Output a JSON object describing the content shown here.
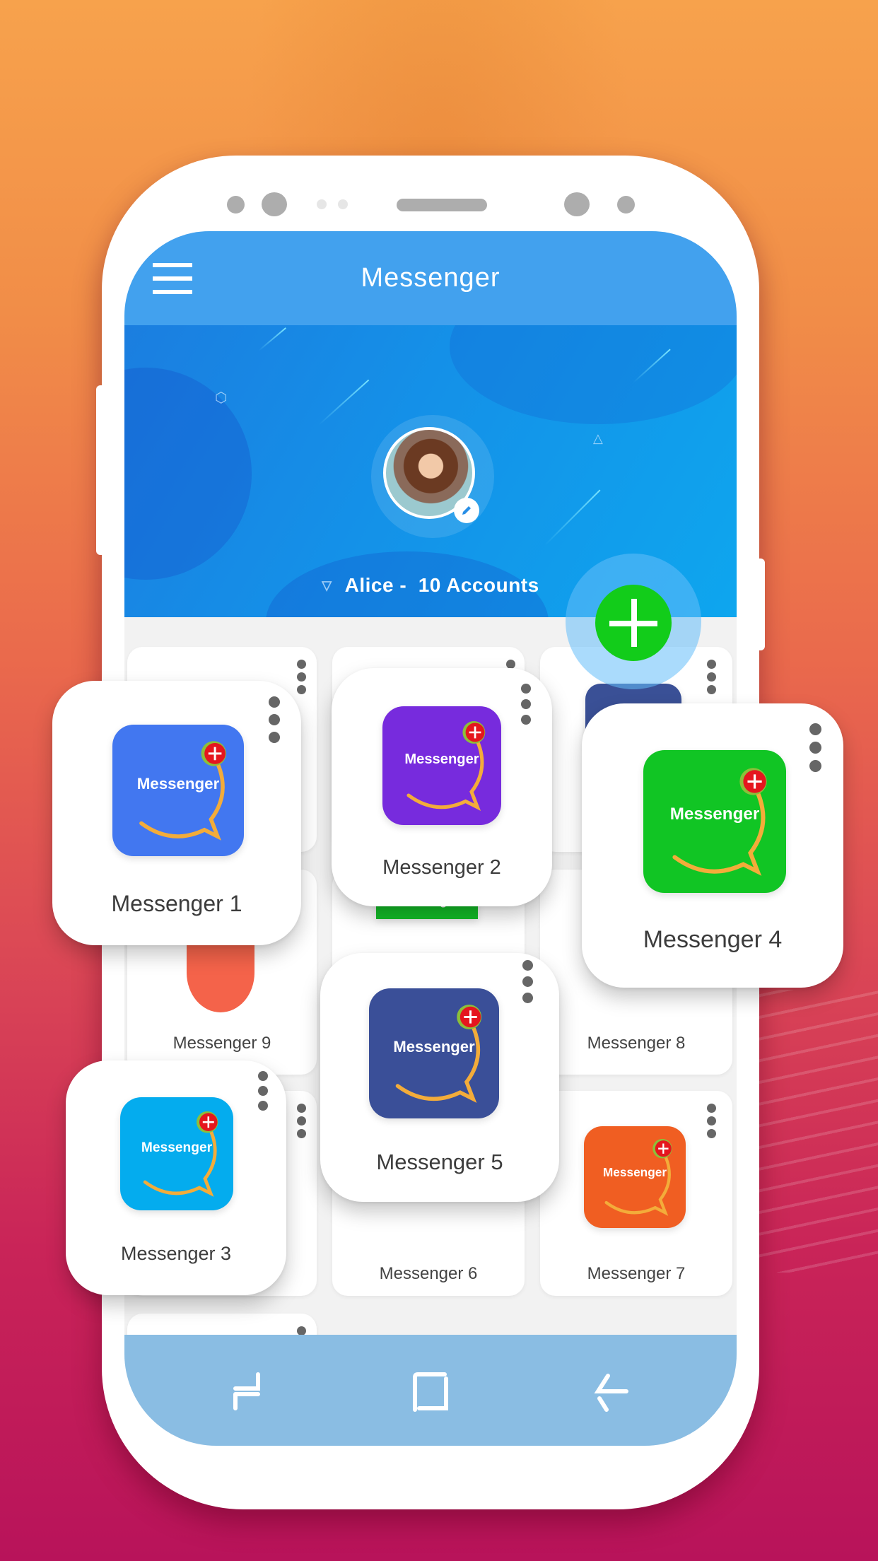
{
  "app": {
    "title": "Messenger",
    "menu_icon": "hamburger-menu-icon"
  },
  "profile": {
    "name": "Alice",
    "separator": " - ",
    "accounts_label": "10 Accounts",
    "avatar_icon": "user-avatar",
    "edit_icon": "pencil-icon",
    "dropdown_icon": "triangle-down-icon"
  },
  "fab": {
    "icon": "plus-icon",
    "label": "Add account"
  },
  "icon_text": "Messenger",
  "featured_accounts": [
    {
      "label": "Messenger 1",
      "color": "#4277f0"
    },
    {
      "label": "Messenger 2",
      "color": "#772bdd"
    },
    {
      "label": "Messenger 3",
      "color": "#04acee"
    },
    {
      "label": "Messenger 4",
      "color": "#11c524"
    },
    {
      "label": "Messenger 5",
      "color": "#3a4f98"
    }
  ],
  "grid_accounts": [
    {
      "label": "Messenger 6"
    },
    {
      "label": "Messenger 7",
      "color": "#f05e22"
    },
    {
      "label": "Messenger 8"
    },
    {
      "label": "Messenger 9"
    }
  ],
  "icon_colors": {
    "bubble_stroke": "#f3ac3a",
    "badge_red": "#e5161e",
    "badge_ring": "#8cbf3a"
  },
  "nav": {
    "recents_icon": "recent-apps-icon",
    "home_icon": "home-square-icon",
    "back_icon": "back-arrow-icon"
  }
}
